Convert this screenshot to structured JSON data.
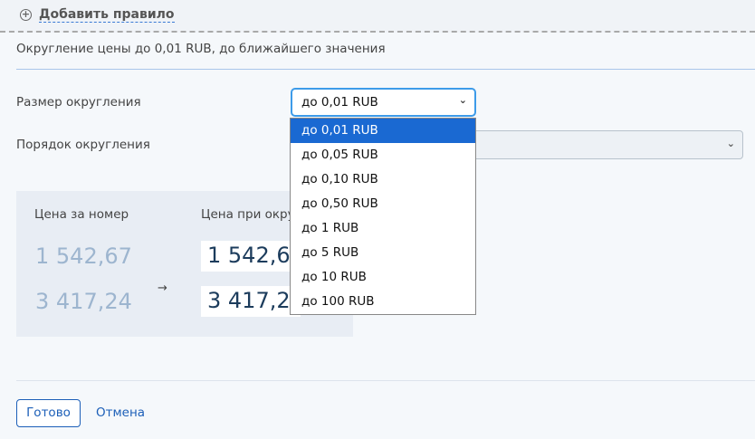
{
  "header": {
    "add_rule": "Добавить правило",
    "add_icon": "plus-circle-icon"
  },
  "summary": "Округление цены до 0,01 RUB, до ближайшего значения",
  "form": {
    "size_label": "Размер округления",
    "size_value": "до 0,01 RUB",
    "order_label": "Порядок округления",
    "options": [
      "до 0,01 RUB",
      "до 0,05 RUB",
      "до 0,10 RUB",
      "до 0,50 RUB",
      "до 1 RUB",
      "до 5 RUB",
      "до 10 RUB",
      "до 100 RUB"
    ],
    "selected_index": 0
  },
  "preview": {
    "col1": "Цена за номер",
    "col2": "Цена при окру",
    "rows": [
      {
        "original": "1 542,67",
        "rounded": "1 542,67"
      },
      {
        "original": "3 417,24",
        "rounded": "3 417,24"
      }
    ],
    "arrow": "→"
  },
  "actions": {
    "done": "Готово",
    "cancel": "Отмена"
  },
  "colors": {
    "accent": "#1c5fb8",
    "selected_option": "#1a69d2",
    "focus": "#3d9be9"
  }
}
